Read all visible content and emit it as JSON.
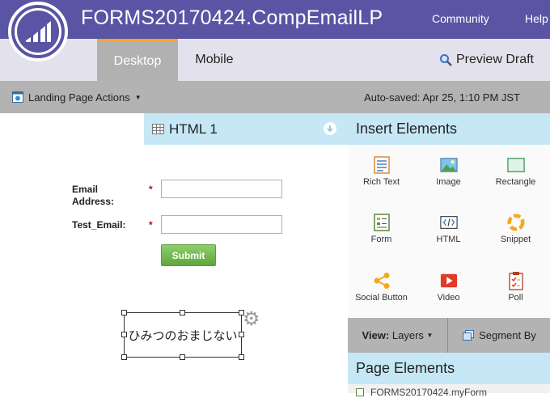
{
  "app": {
    "title": "FORMS20170424.CompEmailLP",
    "nav": [
      "Community",
      "Help"
    ]
  },
  "tabs": [
    {
      "label": "Desktop",
      "active": true
    },
    {
      "label": "Mobile",
      "active": false
    }
  ],
  "preview_label": "Preview Draft",
  "actions": {
    "menu_label": "Landing Page Actions",
    "autosaved": "Auto-saved: Apr 25, 1:10 PM JST"
  },
  "canvas": {
    "html_block_title": "HTML 1",
    "form": {
      "fields": [
        {
          "label": "Email Address:",
          "required": "*",
          "value": ""
        },
        {
          "label": "Test_Email:",
          "required": "*",
          "value": ""
        }
      ],
      "submit_label": "Submit"
    },
    "rich_text": "ひみつのおまじない"
  },
  "panel": {
    "insert_title": "Insert Elements",
    "elements": [
      {
        "label": "Rich Text",
        "icon": "rich-text-icon"
      },
      {
        "label": "Image",
        "icon": "image-icon"
      },
      {
        "label": "Rectangle",
        "icon": "rectangle-icon"
      },
      {
        "label": "Form",
        "icon": "form-icon"
      },
      {
        "label": "HTML",
        "icon": "html-icon"
      },
      {
        "label": "Snippet",
        "icon": "snippet-icon"
      },
      {
        "label": "Social Button",
        "icon": "social-button-icon"
      },
      {
        "label": "Video",
        "icon": "video-icon"
      },
      {
        "label": "Poll",
        "icon": "poll-icon"
      }
    ],
    "view_label": "View:",
    "view_value": "Layers",
    "segment_label": "Segment By",
    "page_elements_title": "Page Elements",
    "page_elements_peek": "FORMS20170424.myForm"
  },
  "colors": {
    "brand": "#5a54a4",
    "accent": "#f4a233",
    "panel_head": "#c6e7f5",
    "submit": "#6fb64b"
  }
}
